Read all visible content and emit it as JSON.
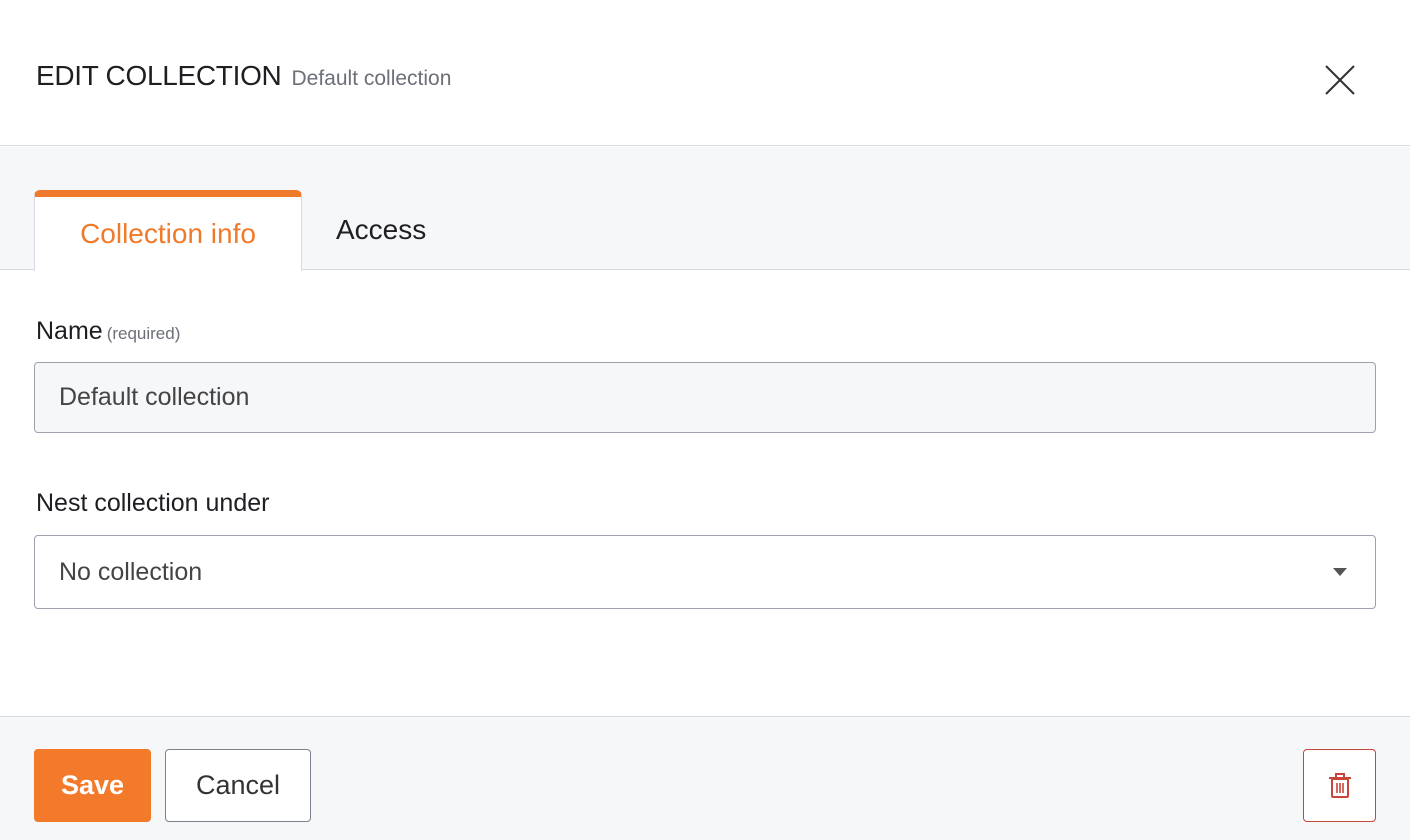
{
  "header": {
    "title": "EDIT COLLECTION",
    "subtitle": "Default collection"
  },
  "tabs": [
    {
      "label": "Collection info",
      "active": true
    },
    {
      "label": "Access",
      "active": false
    }
  ],
  "form": {
    "name": {
      "label": "Name",
      "hint": "(required)",
      "value": "Default collection"
    },
    "nest": {
      "label": "Nest collection under",
      "value": "No collection"
    }
  },
  "footer": {
    "save_label": "Save",
    "cancel_label": "Cancel",
    "delete_icon": "trash-icon"
  },
  "icons": {
    "close": "close-icon",
    "caret": "caret-down-icon"
  },
  "colors": {
    "accent": "#f37a2b",
    "danger": "#c8453a",
    "band": "#f6f7f9",
    "border": "#d7d9e3"
  }
}
